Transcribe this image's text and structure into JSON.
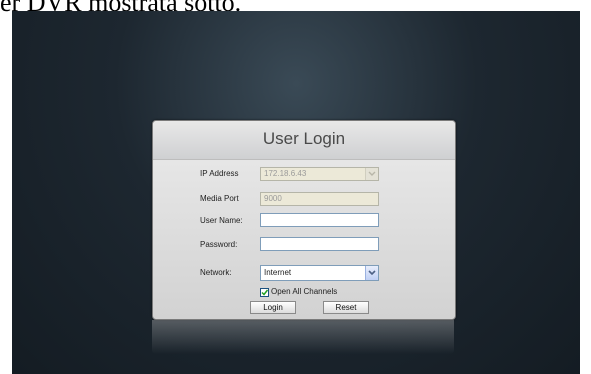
{
  "caption": "er DVR mostrata sotto.",
  "dialog": {
    "title": "User Login",
    "labels": {
      "ip_address": "IP Address",
      "media_port": "Media Port",
      "user_name": "User Name:",
      "password": "Password:",
      "network": "Network:"
    },
    "fields": {
      "ip_address_value": "172.18.6.43",
      "media_port_value": "9000",
      "user_name_value": "",
      "password_value": "",
      "network_value": "Internet"
    },
    "checkbox": {
      "label": "Open All Channels",
      "checked": true
    },
    "buttons": {
      "login": "Login",
      "reset": "Reset"
    }
  },
  "colors": {
    "screen_background": "#1d2730",
    "dialog_background": "#e6e6e6",
    "checkbox_check": "#22a022"
  },
  "icons": {
    "dropdown": "chevron-down-icon",
    "check": "checkmark-icon"
  }
}
